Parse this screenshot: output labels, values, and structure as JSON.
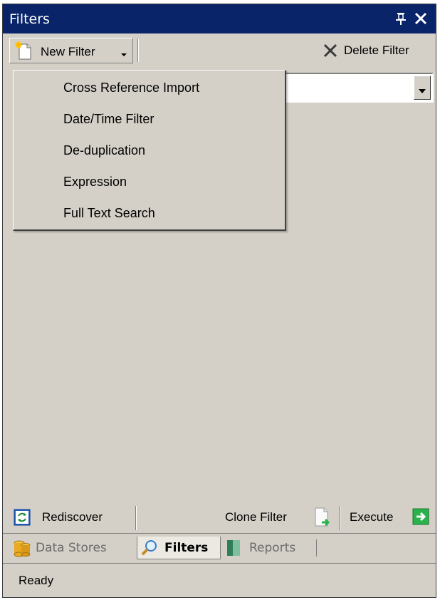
{
  "window": {
    "title": "Filters"
  },
  "titlebar": {
    "pin_icon": "pin-icon",
    "close_icon": "close-icon"
  },
  "toolbar": {
    "new_filter_label": "New Filter",
    "delete_filter_label": "Delete Filter"
  },
  "filter_select": {
    "value": ""
  },
  "new_filter_menu": {
    "items": [
      {
        "label": "Cross Reference Import"
      },
      {
        "label": "Date/Time Filter"
      },
      {
        "label": "De-duplication"
      },
      {
        "label": "Expression"
      },
      {
        "label": "Full Text Search"
      }
    ]
  },
  "actions": {
    "rediscover_label": "Rediscover",
    "clone_filter_label": "Clone Filter",
    "execute_label": "Execute"
  },
  "tabs": [
    {
      "label": "Data Stores",
      "icon": "database-icon",
      "active": false
    },
    {
      "label": "Filters",
      "icon": "magnifier-icon",
      "active": true
    },
    {
      "label": "Reports",
      "icon": "report-icon",
      "active": false
    }
  ],
  "status": {
    "text": "Ready"
  },
  "colors": {
    "titlebar": "#0a246a",
    "panel": "#d4d0c8",
    "execute_green": "#2bb24c"
  }
}
